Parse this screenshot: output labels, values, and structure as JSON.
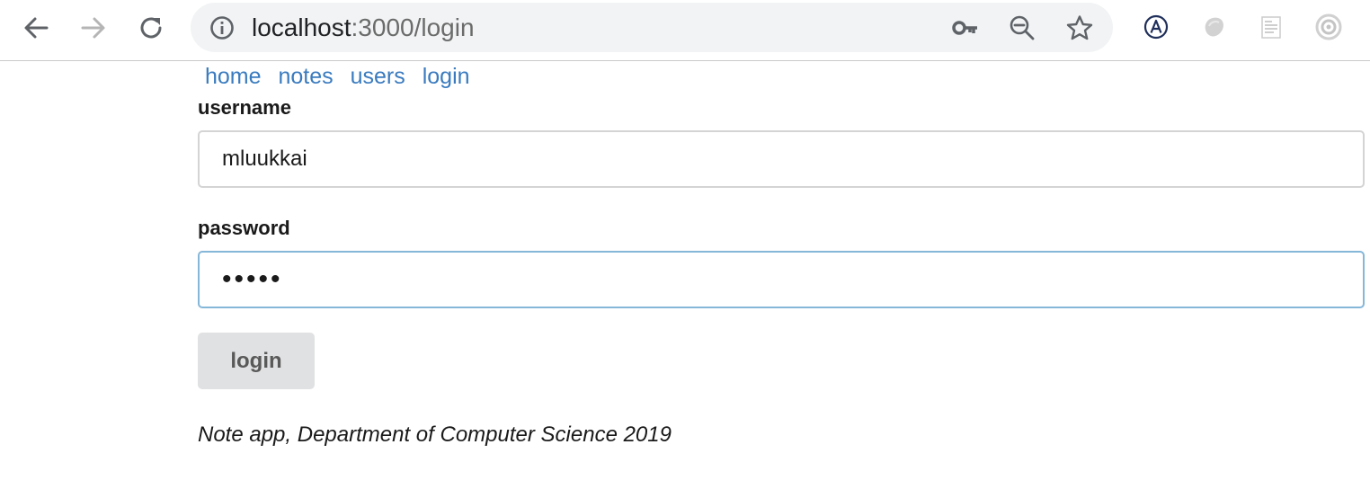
{
  "browser": {
    "url_host": "localhost",
    "url_rest": ":3000/login",
    "icons": {
      "back": "arrow-left-icon",
      "forward": "arrow-right-icon",
      "reload": "reload-icon",
      "info": "info-icon",
      "key": "key-icon",
      "zoom": "zoom-out-icon",
      "bookmark": "star-icon",
      "extensions": [
        "accessibility-a-icon",
        "blob-extension-icon",
        "document-extension-icon",
        "target-extension-icon"
      ]
    }
  },
  "nav": {
    "links": [
      "home",
      "notes",
      "users"
    ],
    "login": "login"
  },
  "form": {
    "username_label": "username",
    "username_value": "mluukkai",
    "password_label": "password",
    "password_value": "•••••",
    "submit_label": "login"
  },
  "footer": {
    "text": "Note app, Department of Computer Science 2019"
  },
  "colors": {
    "link": "#3a7bbf",
    "focus_border": "#85b7d9",
    "button_bg": "#e0e1e2"
  }
}
